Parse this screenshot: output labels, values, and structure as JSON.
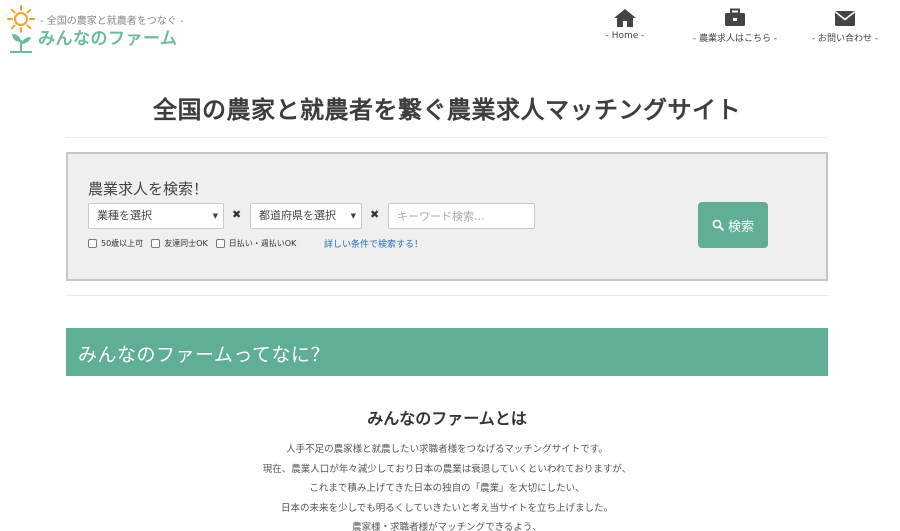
{
  "logo": {
    "tagline": "- 全国の農家と就農者をつなぐ -",
    "name": "みんなのファーム",
    "sun_color": "#f0a030",
    "sprout_color": "#6dba9c"
  },
  "nav": {
    "items": [
      {
        "label": "- Home -",
        "icon": "home-icon"
      },
      {
        "label": "- 農業求人はこちら -",
        "icon": "briefcase-icon"
      },
      {
        "label": "- お問い合わせ -",
        "icon": "envelope-icon"
      }
    ]
  },
  "hero": {
    "title": "全国の農家と就農者を繋ぐ農業求人マッチングサイト"
  },
  "search": {
    "heading": "農業求人を検索！",
    "industry_select": "業種を選択",
    "prefecture_select": "都道府県を選択",
    "separator": "✖",
    "keyword_placeholder": "キーワード検索...",
    "checkboxes": [
      {
        "label": "50歳以上可",
        "checked": false
      },
      {
        "label": "友達同士OK",
        "checked": false
      },
      {
        "label": "日払い・週払いOK",
        "checked": false
      }
    ],
    "detail_link": "詳しい条件で検索する！",
    "button_label": "検索",
    "accent_color": "#5fae95"
  },
  "about": {
    "banner": "みんなのファームってなに？",
    "title": "みんなのファームとは",
    "paragraphs": [
      "人手不足の農家様と就農したい求職者様をつなげるマッチングサイトです。",
      "現在、農業人口が年々減少しており日本の農業は衰退していくといわれておりますが、",
      "これまで積み上げてきた日本の独自の「農業」を大切にしたい、",
      "日本の未来を少しでも明るくしていきたいと考え当サイトを立ち上げました。",
      "農家様・求職者様がマッチングできるよう、"
    ]
  }
}
